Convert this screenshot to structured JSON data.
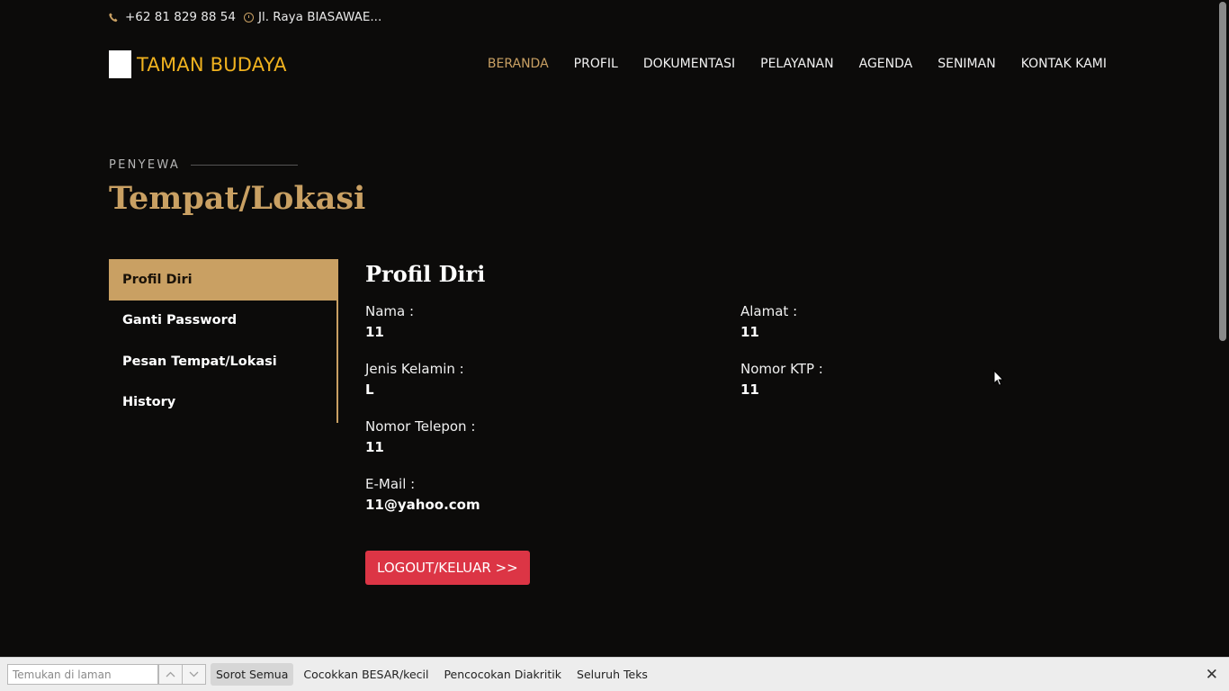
{
  "topbar": {
    "phone": "+62 81 829 88 54",
    "address": "Jl. Raya BIASAWAE..."
  },
  "header": {
    "logo_text": "TAMAN BUDAYA",
    "nav": [
      "BERANDA",
      "PROFIL",
      "DOKUMENTASI",
      "PELAYANAN",
      "AGENDA",
      "SENIMAN",
      "KONTAK KAMI"
    ],
    "active_nav": "BERANDA"
  },
  "section": {
    "label": "PENYEWA",
    "title": "Tempat/Lokasi"
  },
  "sidebar": {
    "items": [
      {
        "label": "Profil Diri",
        "active": true
      },
      {
        "label": "Ganti Password",
        "active": false
      },
      {
        "label": "Pesan Tempat/Lokasi",
        "active": false
      },
      {
        "label": "History",
        "active": false
      }
    ]
  },
  "profile": {
    "heading": "Profil Diri",
    "left": [
      {
        "label": "Nama :",
        "value": "11"
      },
      {
        "label": "Jenis Kelamin :",
        "value": "L"
      },
      {
        "label": "Nomor Telepon :",
        "value": "11"
      },
      {
        "label": "E-Mail :",
        "value": "11@yahoo.com"
      }
    ],
    "right": [
      {
        "label": "Alamat :",
        "value": "11"
      },
      {
        "label": "Nomor KTP :",
        "value": "11"
      }
    ],
    "logout_label": "LOGOUT/KELUAR >>"
  },
  "findbar": {
    "placeholder": "Temukan di laman",
    "highlight_all": "Sorot Semua",
    "match_case": "Cocokkan BESAR/kecil",
    "match_diacritics": "Pencocokan Diakritik",
    "whole_words": "Seluruh Teks"
  },
  "colors": {
    "background": "#0c0b0a",
    "accent_gold": "#c9a063",
    "logo_yellow": "#f0b21f",
    "logout_red": "#dc3545"
  }
}
